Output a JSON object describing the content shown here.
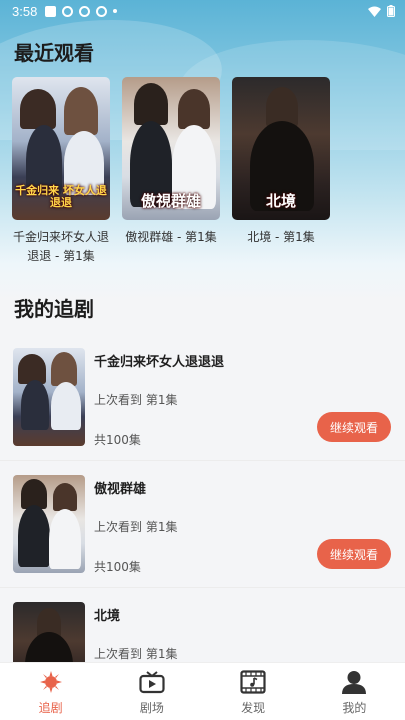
{
  "status_bar": {
    "time": "3:58"
  },
  "recent": {
    "title": "最近观看",
    "items": [
      {
        "label": "千金归来坏女人退退退 - 第1集",
        "poster_text": "千金归来 坏女人退退退"
      },
      {
        "label": "傲视群雄 - 第1集",
        "poster_text": "傲視群雄"
      },
      {
        "label": "北境 - 第1集",
        "poster_text": "北境"
      }
    ]
  },
  "following": {
    "title": "我的追剧",
    "items": [
      {
        "title": "千金归来坏女人退退退",
        "last_watched": "上次看到 第1集",
        "episodes": "共100集",
        "button": "继续观看"
      },
      {
        "title": "傲视群雄",
        "last_watched": "上次看到 第1集",
        "episodes": "共100集",
        "button": "继续观看"
      },
      {
        "title": "北境",
        "last_watched": "上次看到 第1集",
        "episodes": "",
        "button": ""
      }
    ]
  },
  "tabbar": {
    "items": [
      {
        "label": "追剧",
        "icon": "drama-follow-icon",
        "active": true
      },
      {
        "label": "剧场",
        "icon": "tv-icon",
        "active": false
      },
      {
        "label": "发现",
        "icon": "film-music-icon",
        "active": false
      },
      {
        "label": "我的",
        "icon": "user-icon",
        "active": false
      }
    ]
  },
  "colors": {
    "accent": "#e8634a",
    "hero_top": "#5bb3d6",
    "background": "#f4f5f7"
  }
}
